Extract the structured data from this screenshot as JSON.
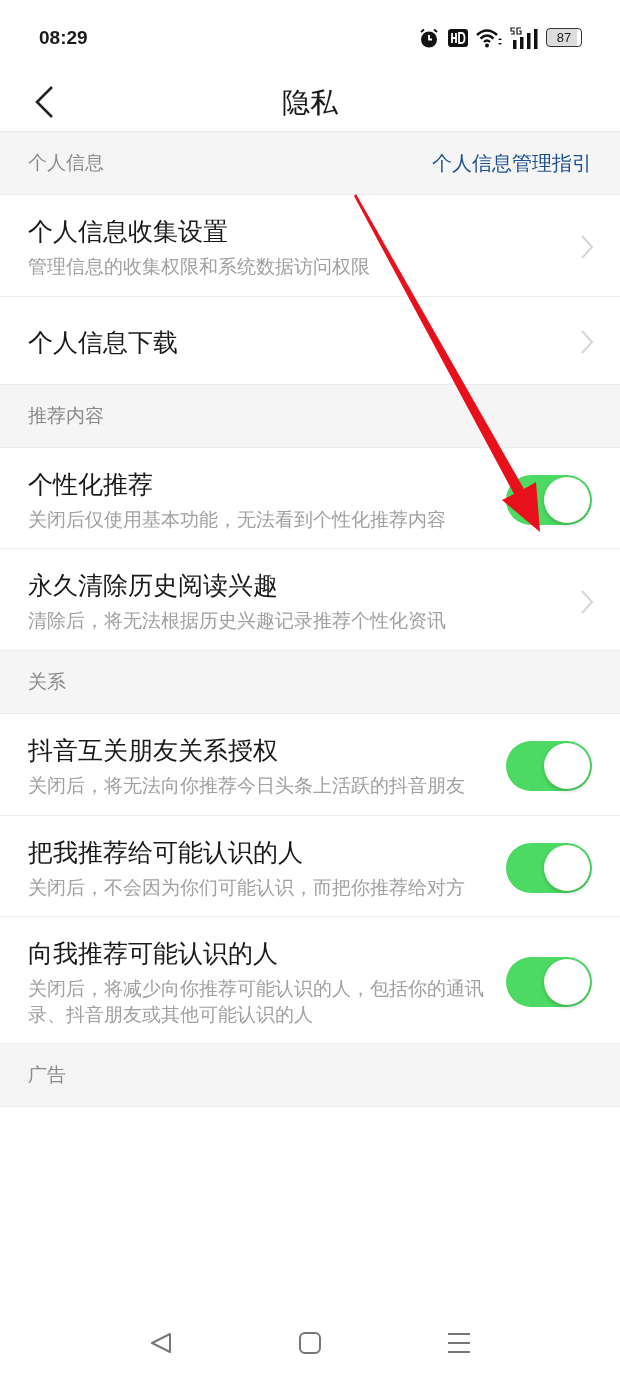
{
  "status_bar": {
    "time": "08:29",
    "battery": "87"
  },
  "header": {
    "title": "隐私"
  },
  "sections": [
    {
      "title": "个人信息",
      "link": "个人信息管理指引",
      "items": [
        {
          "kind": "link",
          "title": "个人信息收集设置",
          "desc": "管理信息的收集权限和系统数据访问权限"
        },
        {
          "kind": "link",
          "title": "个人信息下载"
        }
      ]
    },
    {
      "title": "推荐内容",
      "items": [
        {
          "kind": "toggle",
          "title": "个性化推荐",
          "desc": "关闭后仅使用基本功能，无法看到个性化推荐内容",
          "on": true
        },
        {
          "kind": "link",
          "title": "永久清除历史阅读兴趣",
          "desc": "清除后，将无法根据历史兴趣记录推荐个性化资讯"
        }
      ]
    },
    {
      "title": "关系",
      "items": [
        {
          "kind": "toggle",
          "title": "抖音互关朋友关系授权",
          "desc": "关闭后，将无法向你推荐今日头条上活跃的抖音朋友",
          "on": true
        },
        {
          "kind": "toggle",
          "title": "把我推荐给可能认识的人",
          "desc": "关闭后，不会因为你们可能认识，而把你推荐给对方",
          "on": true
        },
        {
          "kind": "toggle",
          "title": "向我推荐可能认识的人",
          "desc": "关闭后，将减少向你推荐可能认识的人，包括你的通讯录、抖音朋友或其他可能认识的人",
          "on": true
        }
      ]
    },
    {
      "title": "广告"
    }
  ]
}
